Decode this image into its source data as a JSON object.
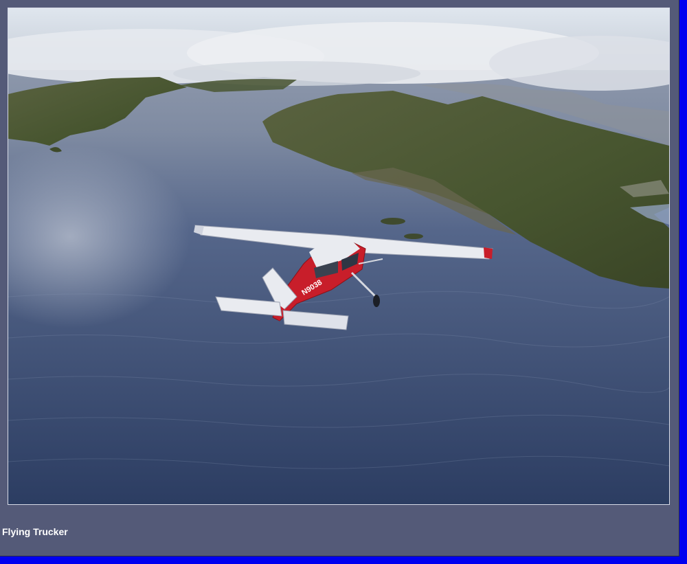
{
  "caption": "Flying Trucker",
  "aircraft": {
    "registration": "N9038"
  },
  "colors": {
    "frame": "#545a78",
    "outer_border": "#0000f0",
    "sea": "#3b4e72",
    "land": "#4b5a34",
    "aircraft_red": "#c81e2a",
    "aircraft_white": "#e9ebf0"
  }
}
